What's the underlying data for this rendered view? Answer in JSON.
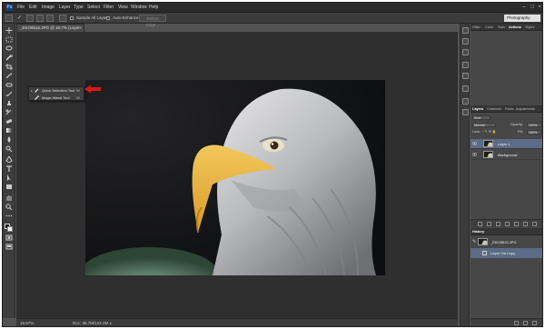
{
  "app": {
    "logo": "Ps",
    "menu": [
      "File",
      "Edit",
      "Image",
      "Layer",
      "Type",
      "Select",
      "Filter",
      "View",
      "Window",
      "Help"
    ],
    "window_controls": [
      "minimize-icon",
      "maximize-icon",
      "close-icon"
    ]
  },
  "options_bar": {
    "sample_all_layers": "Sample All Layers",
    "auto_enhance": "Auto-Enhance",
    "refine_edge": "Refine Edge...",
    "workspace": "Photography"
  },
  "document": {
    "tab_title": "_EKO8515.JPG @ 16.7% (Layer 1, RGB/8)",
    "tab_close": "×"
  },
  "flyout": {
    "items": [
      {
        "label": "Quick Selection Tool",
        "shortcut": "W",
        "icon": "quick-selection-icon",
        "selected": true
      },
      {
        "label": "Magic Wand Tool",
        "shortcut": "W",
        "icon": "magic-wand-icon",
        "selected": false
      }
    ],
    "selected_mark": "•",
    "arrow_color": "#d81a1a"
  },
  "status_bar": {
    "zoom": "16.67%",
    "doc_size": "Doc: 36.7M/122.4M"
  },
  "panels": {
    "top_tabs": [
      "Histo",
      "Color",
      "Swtc",
      "Actions",
      "Styles"
    ],
    "top_active": 3,
    "layers": {
      "tabs": [
        "Layers",
        "Channels",
        "Paths",
        "Adjustments"
      ],
      "filter_label": "Kind",
      "blend_mode": "Normal",
      "opacity_label": "Opacity:",
      "opacity_value": "100%",
      "lock_label": "Lock:",
      "fill_label": "Fill:",
      "fill_value": "100%",
      "items": [
        {
          "name": "Layer 1",
          "selected": true
        },
        {
          "name": "Background",
          "selected": false
        }
      ]
    },
    "history": {
      "tab": "History",
      "items": [
        {
          "name": "_EKO8515.JPG",
          "selected": false,
          "is_snapshot": true
        },
        {
          "name": "Layer Via Copy",
          "selected": true,
          "is_snapshot": false
        }
      ]
    }
  },
  "colors": {
    "app_bg": "#535353",
    "canvas_bg": "#2f2f2f",
    "selected_layer": "#5c6b86",
    "menubar": "#2b2b2b"
  }
}
